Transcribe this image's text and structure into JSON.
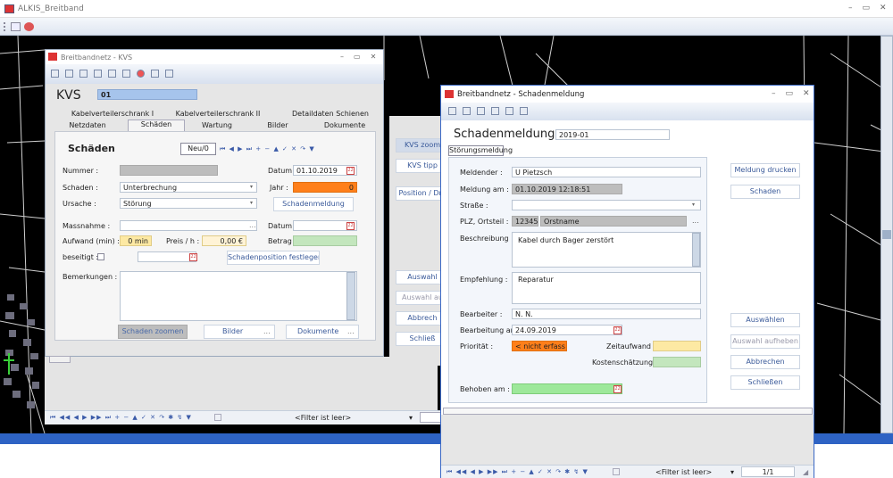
{
  "app": {
    "title": "ALKIS_Breitband"
  },
  "kvs": {
    "title": "Breitbandnetz - KVS",
    "heading": "KVS",
    "id": "01",
    "tabs_row1": [
      "Kabelverteilerschrank I",
      "Kabelverteilerschrank II",
      "Detaildaten Schienen"
    ],
    "tabs_row2": [
      "Netzdaten",
      "Schäden",
      "Wartung",
      "Bilder",
      "Dokumente"
    ],
    "section": "Schäden",
    "new_btn": "Neu/0",
    "nummer_label": "Nummer :",
    "datum_label": "Datum :",
    "datum_value": "01.10.2019",
    "schaden_label": "Schaden :",
    "schaden_value": "Unterbrechung",
    "jahr_label": "Jahr :",
    "jahr_value": "0",
    "ursache_label": "Ursache :",
    "ursache_value": "Störung",
    "schadenmeldung_btn": "Schadenmeldung",
    "massnahme_label": "Massnahme :",
    "datum2_label": "Datum :",
    "aufwand_label": "Aufwand (min) :",
    "aufwand_value": "0 min",
    "preis_label": "Preis / h :",
    "preis_value": "0,00 €",
    "betrag_label": "Betrag :",
    "beseitigt_label": "beseitigt :",
    "schadenposition_btn": "Schadenposition festlegen",
    "bemerkungen_label": "Bemerkungen :",
    "schaden_zoomen_btn": "Schaden zoomen",
    "bilder_btn": "Bilder",
    "dokumente_btn": "Dokumente",
    "dots": "..."
  },
  "right_panel": {
    "buttons": [
      "KVS zoom",
      "KVS tipp",
      "Position / Dre",
      "Auswahl",
      "Auswahl au",
      "Abbrech",
      "Schließ"
    ]
  },
  "bg_bottom": {
    "filter": "<Filter ist leer>"
  },
  "sm": {
    "title": "Breitbandnetz - Schadenmeldung",
    "heading": "Schadenmeldung",
    "id": "2019-01",
    "tab": "Störungsmeldung",
    "meldender_label": "Meldender :",
    "meldender_value": "U Pietzsch",
    "meldung_am_label": "Meldung am :",
    "meldung_am_value": "01.10.2019 12:18:51",
    "strasse_label": "Straße :",
    "plz_label": "PLZ, Ortsteil :",
    "plz_value": "12345",
    "ort_value": "Orstname",
    "beschreibung_label": "Beschreibung :",
    "beschreibung_value": "Kabel durch Bager zerstört",
    "empfehlung_label": "Empfehlung :",
    "empfehlung_value": "Reparatur",
    "bearbeiter_label": "Bearbeiter :",
    "bearbeiter_value": "N. N.",
    "bearbeitung_label": "Bearbeitung am :",
    "bearbeitung_value": "24.09.2019",
    "prioritaet_label": "Priorität :",
    "prioritaet_value": "< nicht erfass",
    "zeitaufwand_label": "Zeitaufwand :",
    "kosten_label": "Kostenschätzung :",
    "behoben_label": "Behoben am :",
    "buttons": [
      "Meldung drucken",
      "Schaden",
      "Auswählen",
      "Auswahl aufheben",
      "Abbrechen",
      "Schließen"
    ],
    "filter": "<Filter ist leer>",
    "page": "1/1",
    "dots": "..."
  },
  "colors": {
    "accent": "#3a5a9a",
    "orange": "#ff7f1a",
    "green": "#c3e6bd",
    "yellow": "#fde9a3",
    "chrome": "#d4dceb"
  }
}
